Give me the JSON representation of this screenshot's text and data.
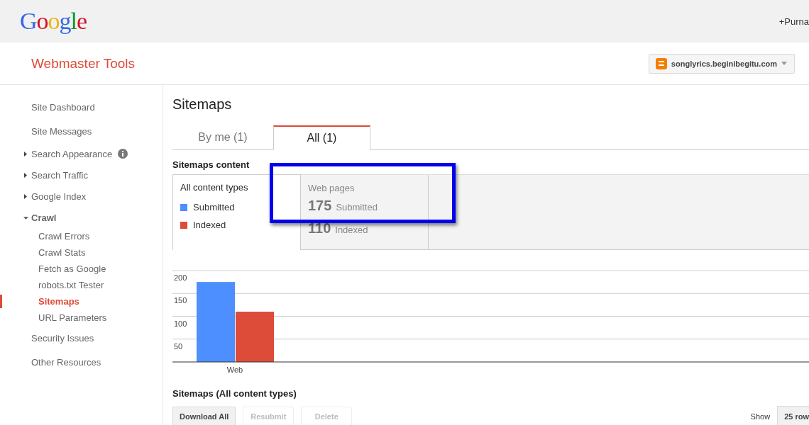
{
  "header": {
    "logo": "Google",
    "account": "+Purna"
  },
  "product": {
    "title": "Webmaster Tools",
    "site": "songlyrics.beginibegitu.com"
  },
  "sidebar": {
    "items": [
      {
        "label": "Site Dashboard",
        "kind": "link",
        "info": false
      },
      {
        "label": "Site Messages",
        "kind": "link",
        "info": false
      },
      {
        "label": "Search Appearance",
        "kind": "group",
        "expanded": false,
        "info": true
      },
      {
        "label": "Search Traffic",
        "kind": "group",
        "expanded": false,
        "info": false
      },
      {
        "label": "Google Index",
        "kind": "group",
        "expanded": false,
        "info": false
      },
      {
        "label": "Crawl",
        "kind": "group",
        "expanded": true,
        "info": false,
        "children": [
          {
            "label": "Crawl Errors",
            "selected": false
          },
          {
            "label": "Crawl Stats",
            "selected": false
          },
          {
            "label": "Fetch as Google",
            "selected": false
          },
          {
            "label": "robots.txt Tester",
            "selected": false
          },
          {
            "label": "Sitemaps",
            "selected": true
          },
          {
            "label": "URL Parameters",
            "selected": false
          }
        ]
      },
      {
        "label": "Security Issues",
        "kind": "link",
        "info": false
      },
      {
        "label": "Other Resources",
        "kind": "link",
        "info": false
      }
    ]
  },
  "page": {
    "title": "Sitemaps",
    "tabs": [
      {
        "label": "By me (1)",
        "selected": false
      },
      {
        "label": "All (1)",
        "selected": true
      }
    ],
    "content_heading": "Sitemaps content",
    "legend": {
      "title": "All content types"
    },
    "stats": {
      "title": "Web pages",
      "rows": [
        {
          "value": "175",
          "label": "Submitted"
        },
        {
          "value": "110",
          "label": "Indexed"
        }
      ]
    },
    "chart_data": {
      "type": "bar",
      "categories": [
        "Web"
      ],
      "series": [
        {
          "name": "Submitted",
          "color": "#4d8fff",
          "values": [
            175
          ]
        },
        {
          "name": "Indexed",
          "color": "#dd4b39",
          "values": [
            110
          ]
        }
      ],
      "ylim": [
        0,
        200
      ],
      "yticks": [
        50,
        100,
        150,
        200
      ],
      "grid": true
    },
    "list_heading": "Sitemaps (All content types)",
    "buttons": [
      {
        "label": "Download All",
        "disabled": false
      },
      {
        "label": "Resubmit",
        "disabled": true
      },
      {
        "label": "Delete",
        "disabled": true
      }
    ],
    "show_label": "Show",
    "rows_select": "25 row"
  }
}
